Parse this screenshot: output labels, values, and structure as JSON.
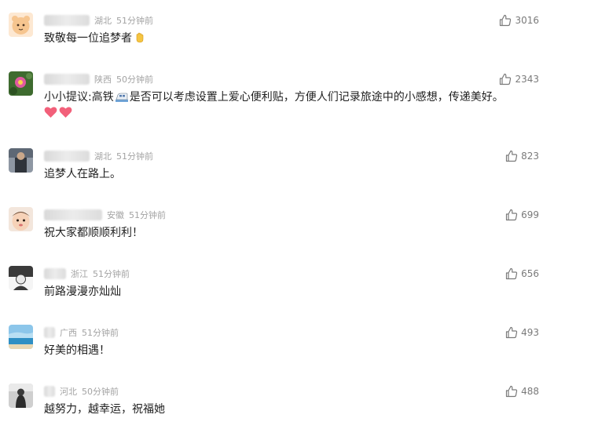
{
  "comments": [
    {
      "region": "湖北",
      "time": "51分钟前",
      "text": "致敬每一位追梦者",
      "likes": "3016",
      "emoji": "raised-hand-emoji"
    },
    {
      "region": "陕西",
      "time": "50分钟前",
      "text_before": "小小提议:高铁",
      "text_after": "是否可以考虑设置上爱心便利贴，方便人们记录旅途中的小感想，传递美好。",
      "likes": "2343",
      "emoji": "train-emoji",
      "extra_emoji": [
        "heart-emoji",
        "heart-emoji"
      ]
    },
    {
      "region": "湖北",
      "time": "51分钟前",
      "text": "追梦人在路上。",
      "likes": "823"
    },
    {
      "region": "安徽",
      "time": "51分钟前",
      "text": "祝大家都顺顺利利！",
      "likes": "699"
    },
    {
      "region": "浙江",
      "time": "51分钟前",
      "text": "前路漫漫亦灿灿",
      "likes": "656"
    },
    {
      "region": "广西",
      "time": "51分钟前",
      "text": "好美的相遇！",
      "likes": "493"
    },
    {
      "region": "河北",
      "time": "50分钟前",
      "text": "越努力，越幸运，祝福她",
      "likes": "488"
    }
  ],
  "icons": {
    "like": "thumbs-up-icon"
  },
  "colors": {
    "meta_text": "#a3a3a3",
    "like_icon": "#7a7a7a",
    "heart": "#f2607a"
  }
}
